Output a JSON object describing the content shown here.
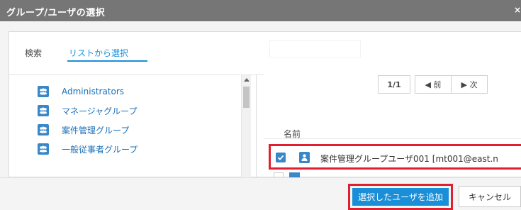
{
  "dialog": {
    "title": "グループ/ユーザの選択",
    "close_glyph": "×"
  },
  "tabs": [
    {
      "label": "検索"
    },
    {
      "label": "リストから選択",
      "active": true
    }
  ],
  "search": {
    "value": "",
    "placeholder": ""
  },
  "groups": [
    {
      "label": "Administrators"
    },
    {
      "label": "マネージャグループ"
    },
    {
      "label": "案件管理グループ"
    },
    {
      "label": "一般従事者グループ"
    }
  ],
  "pager": {
    "count": "1/1",
    "prev": "◀ 前",
    "next": "▶ 次"
  },
  "users": {
    "column_header": "名前",
    "rows": [
      {
        "label": "案件管理グループユーザ001 [mt001@east.n",
        "checked": true
      }
    ]
  },
  "footer": {
    "add_label": "選択したユーザを追加",
    "cancel_label": "キャンセル"
  },
  "colors": {
    "accent": "#1a8fd8",
    "icon_blue": "#3a87c8",
    "highlight_red": "#e02030",
    "titlebar": "#767676"
  },
  "icons": {
    "group": "group-icon",
    "user": "user-icon",
    "checkbox": "checkbox-checked-icon",
    "close": "close-icon"
  }
}
